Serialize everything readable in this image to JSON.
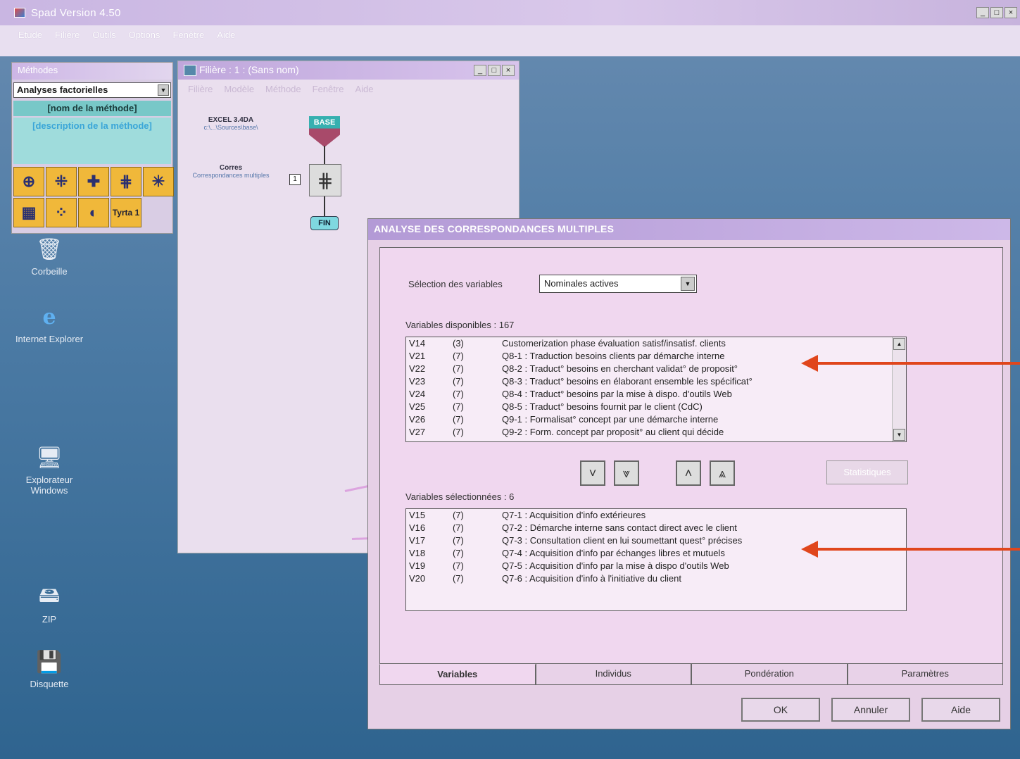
{
  "app": {
    "title": "Spad Version 4.50",
    "menu": [
      "Etude",
      "Filière",
      "Outils",
      "Options",
      "Fenêtre",
      "Aide"
    ],
    "controls": [
      "_",
      "□",
      "×"
    ]
  },
  "palette": {
    "title": "Méthodes",
    "category": "Analyses factorielles",
    "method_name": "[nom de la méthode]",
    "method_description": "[description de la méthode]",
    "last_tool_label": "Tyrta 1"
  },
  "filiere": {
    "title": "Filière : 1 : (Sans nom)",
    "menu": [
      "Filière",
      "Modèle",
      "Méthode",
      "Fenêtre",
      "Aide"
    ],
    "source_label": "EXCEL 3.4DA",
    "source_sub": "c:\\...\\Sources\\base\\",
    "step_label": "Corres",
    "step_sub": "Correspondances multiples",
    "base_label": "BASE",
    "step_number": "1",
    "fin_label": "FIN"
  },
  "desktop_icons": [
    {
      "label": "Corbeille",
      "icon": "recycle-bin-icon"
    },
    {
      "label": "Internet Explorer",
      "icon": "internet-explorer-icon"
    },
    {
      "label": "Explorateur Windows",
      "icon": "explorer-icon"
    },
    {
      "label": "ZIP",
      "icon": "zip-drive-icon"
    },
    {
      "label": "Disquette",
      "icon": "floppy-icon"
    }
  ],
  "dialog": {
    "title": "ANALYSE DES CORRESPONDANCES MULTIPLES",
    "selection_label": "Sélection des variables",
    "selection_value": "Nominales actives",
    "available_label": "Variables disponibles : 167",
    "selected_label": "Variables sélectionnées : 6",
    "statistiques_label": "Statistiques",
    "available": [
      {
        "code": "V14",
        "n": "(3)",
        "text": "Customerization phase évaluation satisf/insatisf. clients"
      },
      {
        "code": "V21",
        "n": "(7)",
        "text": "Q8-1 : Traduction besoins clients par démarche interne"
      },
      {
        "code": "V22",
        "n": "(7)",
        "text": "Q8-2 : Traduct° besoins en cherchant validat° de proposit°"
      },
      {
        "code": "V23",
        "n": "(7)",
        "text": "Q8-3 : Traduct° besoins en élaborant ensemble les spécificat°"
      },
      {
        "code": "V24",
        "n": "(7)",
        "text": "Q8-4 : Traduct° besoins par la mise à dispo. d'outils Web"
      },
      {
        "code": "V25",
        "n": "(7)",
        "text": "Q8-5 : Traduct° besoins fournit par le client (CdC)"
      },
      {
        "code": "V26",
        "n": "(7)",
        "text": "Q9-1 : Formalisat° concept par une démarche interne"
      },
      {
        "code": "V27",
        "n": "(7)",
        "text": "Q9-2 : Form. concept par proposit° au client qui décide"
      }
    ],
    "selected": [
      {
        "code": "V15",
        "n": "(7)",
        "text": "Q7-1 : Acquisition d'info extérieures"
      },
      {
        "code": "V16",
        "n": "(7)",
        "text": "Q7-2 : Démarche interne sans contact direct avec le client"
      },
      {
        "code": "V17",
        "n": "(7)",
        "text": "Q7-3 : Consultation client en lui soumettant quest° précises"
      },
      {
        "code": "V18",
        "n": "(7)",
        "text": "Q7-4 : Acquisition d'info par échanges libres et mutuels"
      },
      {
        "code": "V19",
        "n": "(7)",
        "text": "Q7-5 : Acquisition d'info par la mise à dispo d'outils Web"
      },
      {
        "code": "V20",
        "n": "(7)",
        "text": "Q7-6 : Acquisition d'info à l'initiative du client"
      }
    ],
    "tabs": [
      "Variables",
      "Individus",
      "Pondération",
      "Paramètres"
    ],
    "buttons": {
      "ok": "OK",
      "cancel": "Annuler",
      "help": "Aide"
    }
  },
  "colors": {
    "annotation_arrow": "#e0461c",
    "desktop": "#3d6d95",
    "dialog": "#e6d0e6"
  }
}
